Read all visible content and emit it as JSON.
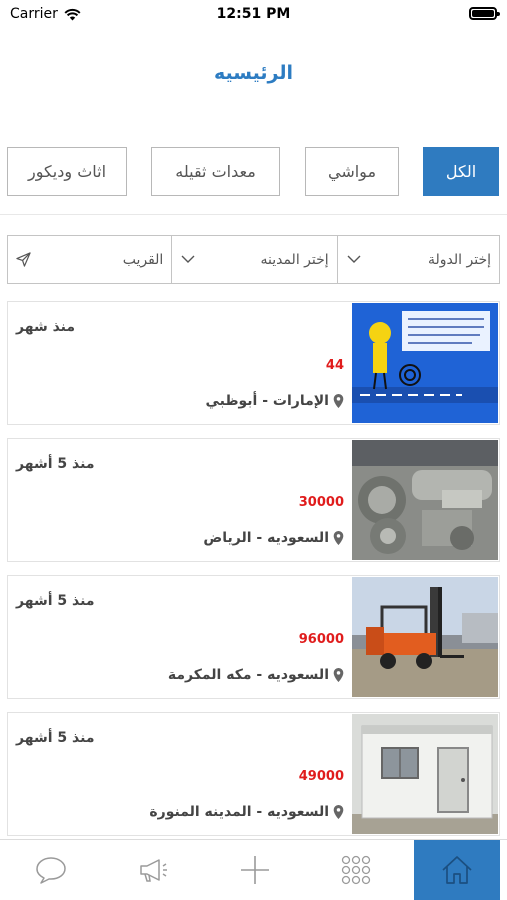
{
  "status_bar": {
    "carrier": "Carrier",
    "time": "12:51 PM"
  },
  "header": {
    "title": "الرئيسيه"
  },
  "tabs": [
    {
      "label": "الكل",
      "active": true
    },
    {
      "label": "مواشي",
      "active": false
    },
    {
      "label": "معدات ثقيله",
      "active": false
    },
    {
      "label": "اثاث وديكور",
      "active": false
    }
  ],
  "filters": {
    "country_placeholder": "إختر الدولة",
    "city_placeholder": "إختر المدينه",
    "nearby_label": "القريب"
  },
  "listings": [
    {
      "time_ago": "منذ شهر",
      "price": "44",
      "location": "الإمارات - أبوظبي",
      "image": "cartoon-poster"
    },
    {
      "time_ago": "منذ 5 أشهر",
      "price": "30000",
      "location": "السعوديه - الرياض",
      "image": "machinery-parts"
    },
    {
      "time_ago": "منذ 5 أشهر",
      "price": "96000",
      "location": "السعوديه - مكه المكرمة",
      "image": "forklift"
    },
    {
      "time_ago": "منذ 5 أشهر",
      "price": "49000",
      "location": "السعوديه - المدينه المنورة",
      "image": "portable-cabin"
    }
  ],
  "bottom_nav": [
    {
      "icon": "chat-bubble-icon",
      "active": false
    },
    {
      "icon": "megaphone-icon",
      "active": false
    },
    {
      "icon": "plus-icon",
      "active": false
    },
    {
      "icon": "grid-dots-icon",
      "active": false
    },
    {
      "icon": "home-icon",
      "active": true
    }
  ],
  "colors": {
    "accent": "#2f7bc0",
    "title": "#2d7cc2",
    "price": "#e01c1c"
  }
}
